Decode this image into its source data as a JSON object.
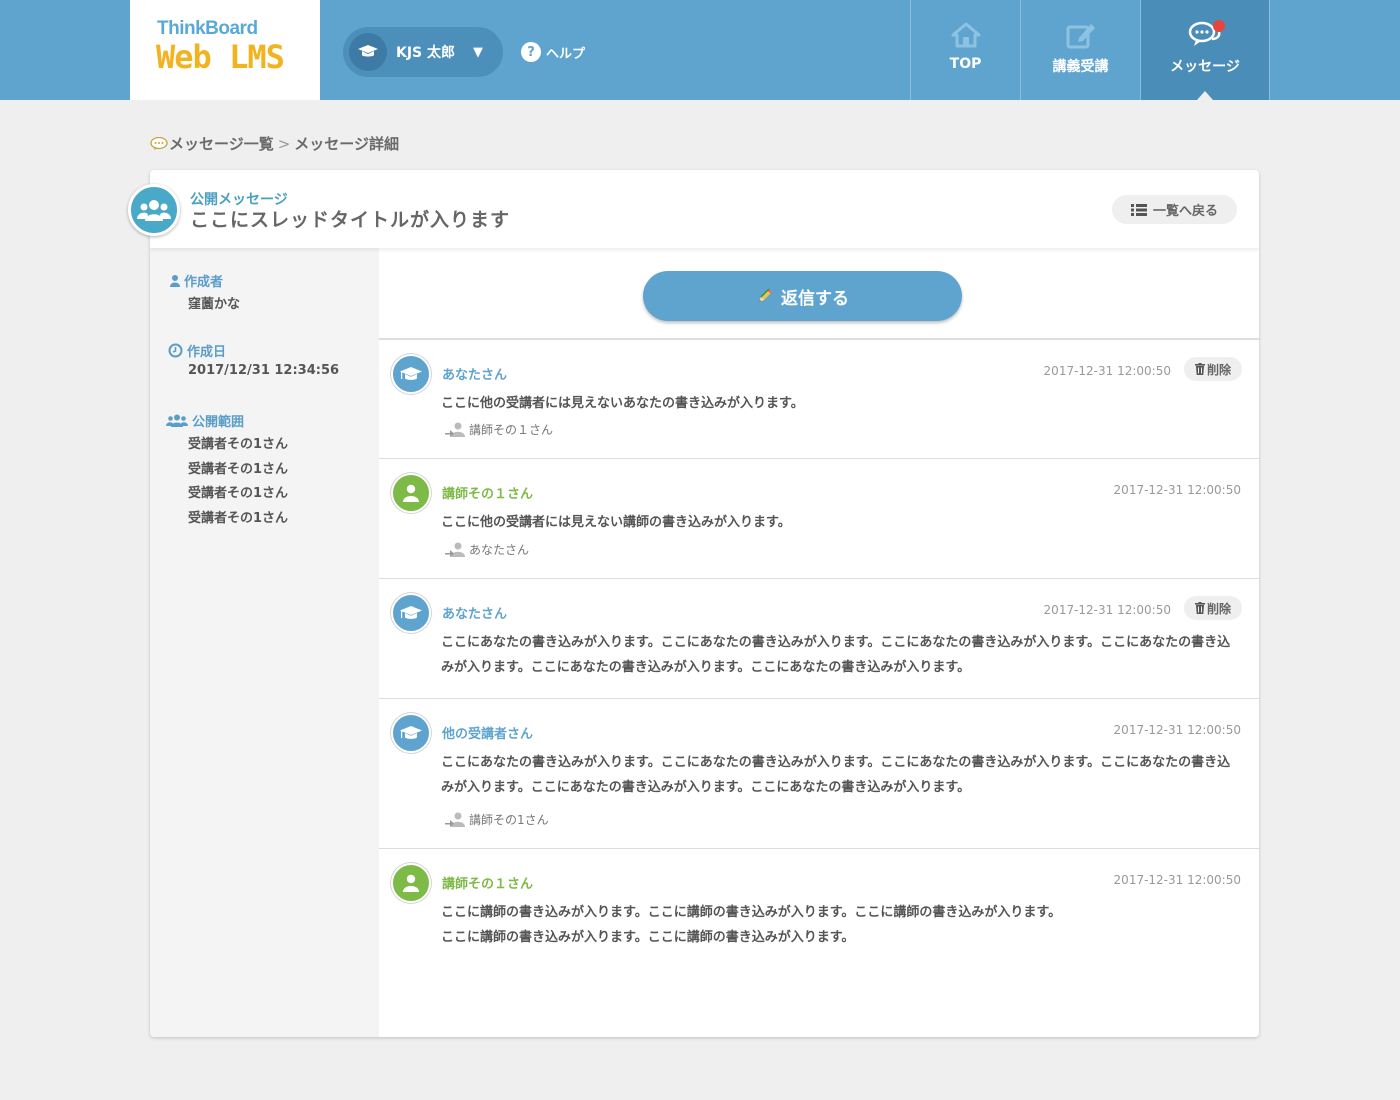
{
  "header": {
    "logo_top": "ThinkBoard",
    "logo_bottom": "Web LMS",
    "user_name": "KJS 太郎",
    "help_label": "ヘルプ",
    "help_icon": "question-circle-icon",
    "nav": [
      {
        "label": "TOP",
        "icon": "home-icon"
      },
      {
        "label": "講義受講",
        "icon": "edit-icon"
      },
      {
        "label": "メッセージ",
        "icon": "chat-bubbles-icon",
        "active": true,
        "has_notification": true
      }
    ],
    "colors": {
      "bar": "#5fa4cf",
      "active": "#4b8db9",
      "logo_yellow": "#f1b420",
      "logo_blue": "#58a9d6"
    }
  },
  "breadcrumb": {
    "items": [
      "メッセージ一覧",
      "メッセージ詳細"
    ],
    "separator": ">"
  },
  "thread": {
    "type_label": "公開メッセージ",
    "title": "ここにスレッドタイトルが入ります",
    "back_label": "一覧へ戻る",
    "reply_label": "返信する"
  },
  "sidebar": {
    "author_label": "作成者",
    "author": "窪薗かな",
    "created_label": "作成日",
    "created": "2017/12/31 12:34:56",
    "scope_label": "公開範囲",
    "scope": [
      "受講者その1さん",
      "受講者その1さん",
      "受講者その1さん",
      "受講者その1さん"
    ]
  },
  "posts": [
    {
      "name": "あなたさん",
      "role": "student",
      "date": "2017-12-31 12:00:50",
      "delete_label": "削除",
      "body": "ここに他の受講者には見えないあなたの書き込みが入ります。",
      "to": "講師その１さん"
    },
    {
      "name": "講師その１さん",
      "role": "teacher",
      "date": "2017-12-31 12:00:50",
      "body": "ここに他の受講者には見えない講師の書き込みが入ります。",
      "to": "あなたさん"
    },
    {
      "name": "あなたさん",
      "role": "student",
      "date": "2017-12-31 12:00:50",
      "delete_label": "削除",
      "body": "ここにあなたの書き込みが入ります。ここにあなたの書き込みが入ります。ここにあなたの書き込みが入ります。ここにあなたの書き込みが入ります。ここにあなたの書き込みが入ります。ここにあなたの書き込みが入ります。"
    },
    {
      "name": "他の受講者さん",
      "role": "student",
      "date": "2017-12-31 12:00:50",
      "body": "ここにあなたの書き込みが入ります。ここにあなたの書き込みが入ります。ここにあなたの書き込みが入ります。ここにあなたの書き込みが入ります。ここにあなたの書き込みが入ります。ここにあなたの書き込みが入ります。",
      "to": "講師その1さん"
    },
    {
      "name": "講師その１さん",
      "role": "teacher",
      "date": "2017-12-31 12:00:50",
      "body_lines": [
        "ここに講師の書き込みが入ります。ここに講師の書き込みが入ります。ここに講師の書き込みが入ります。",
        "ここに講師の書き込みが入ります。ここに講師の書き込みが入ります。"
      ]
    }
  ],
  "role_colors": {
    "student": "#5fa4cf",
    "teacher": "#7dba47"
  }
}
